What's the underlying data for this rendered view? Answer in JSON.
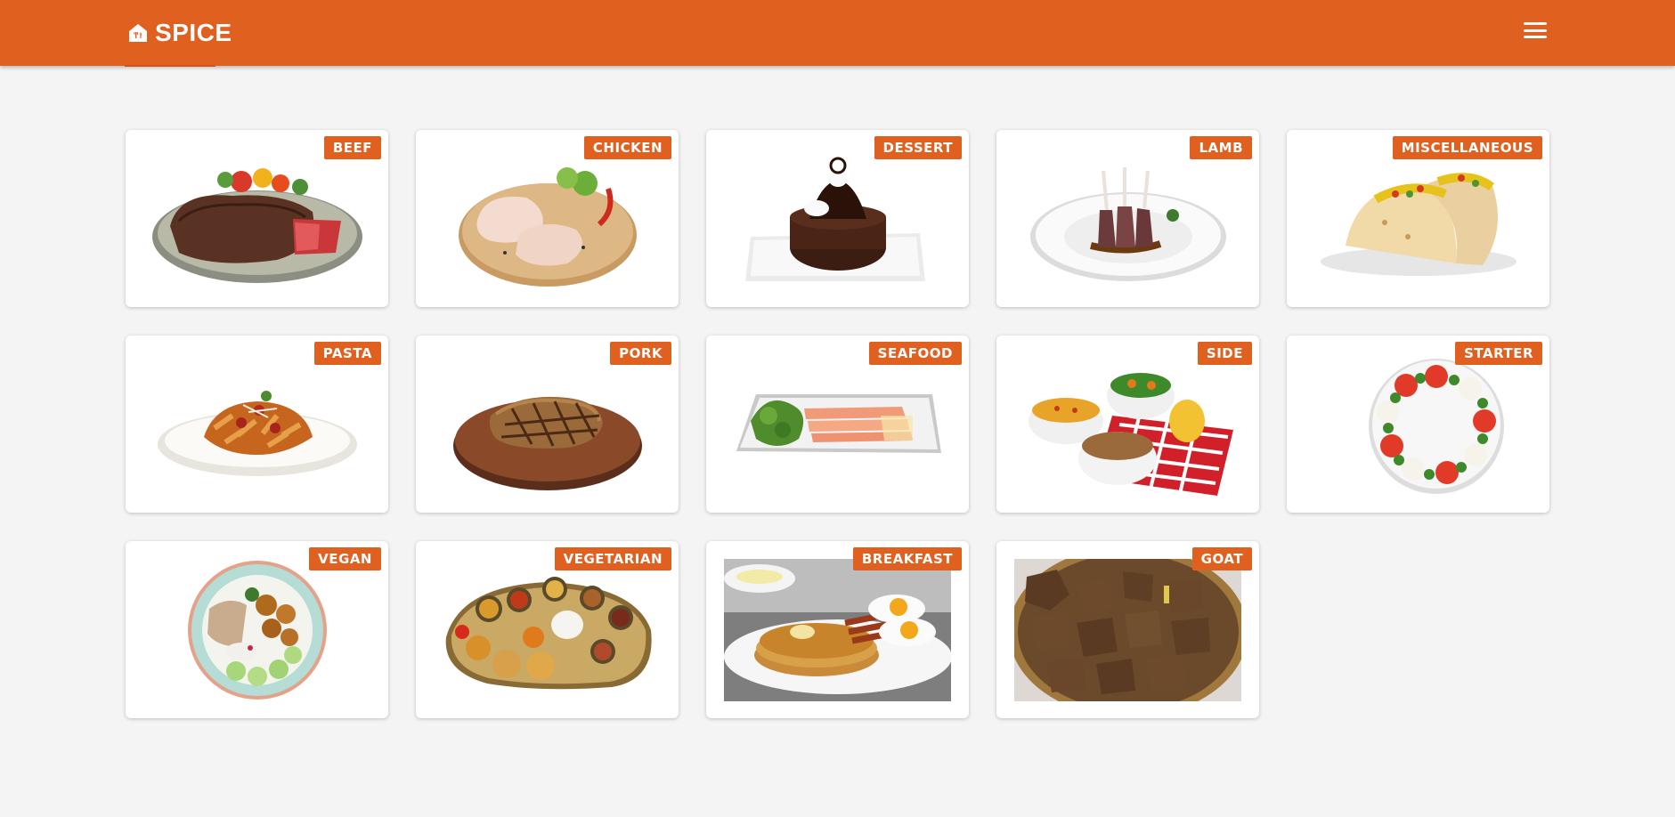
{
  "header": {
    "brand": "SPICE",
    "brand_icon": "house-fork-knife-icon",
    "menu_icon": "hamburger-menu-icon",
    "accent_color": "#e06020"
  },
  "categories": [
    {
      "label": "BEEF",
      "image": "steak-plate-image"
    },
    {
      "label": "CHICKEN",
      "image": "raw-chicken-board-image"
    },
    {
      "label": "DESSERT",
      "image": "chocolate-cake-image"
    },
    {
      "label": "LAMB",
      "image": "lamb-chops-image"
    },
    {
      "label": "MISCELLANEOUS",
      "image": "tacos-image"
    },
    {
      "label": "PASTA",
      "image": "penne-bowl-image"
    },
    {
      "label": "PORK",
      "image": "pork-chop-board-image"
    },
    {
      "label": "SEAFOOD",
      "image": "salmon-platter-image"
    },
    {
      "label": "SIDE",
      "image": "side-dishes-image"
    },
    {
      "label": "STARTER",
      "image": "caprese-plate-image"
    },
    {
      "label": "VEGAN",
      "image": "vegan-bowl-image"
    },
    {
      "label": "VEGETARIAN",
      "image": "thali-platter-image"
    },
    {
      "label": "BREAKFAST",
      "image": "pancakes-eggs-image"
    },
    {
      "label": "GOAT",
      "image": "goat-stew-image"
    }
  ]
}
